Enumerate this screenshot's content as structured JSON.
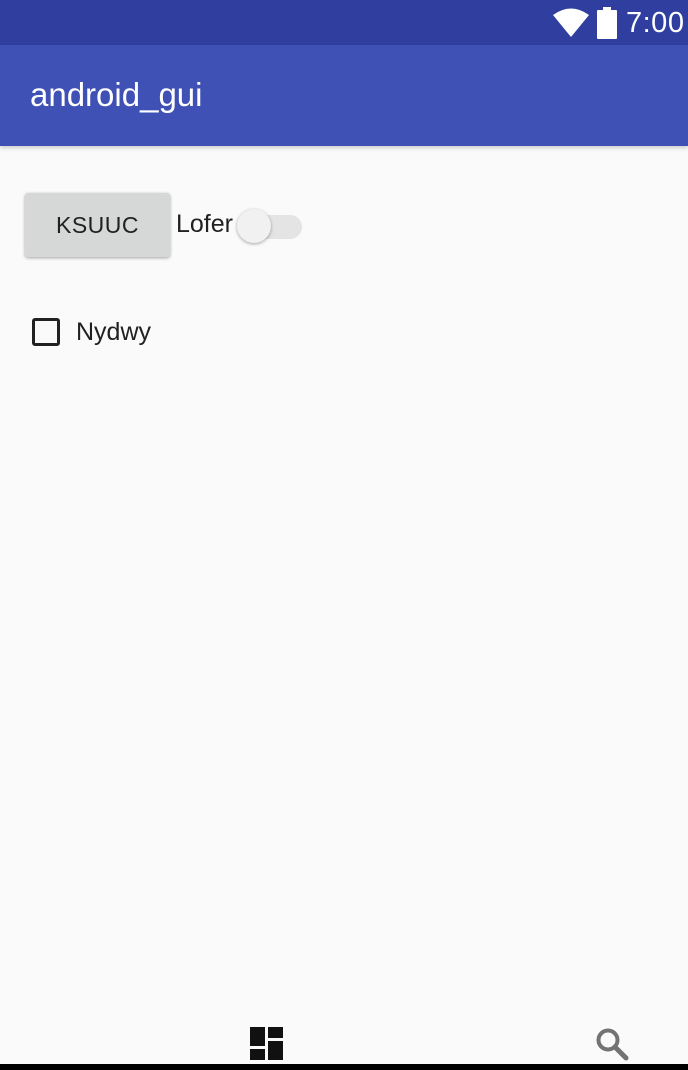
{
  "status_bar": {
    "time": "7:00",
    "icons": [
      "wifi-icon",
      "battery-icon"
    ]
  },
  "app_bar": {
    "title": "android_gui"
  },
  "content": {
    "button_label": "KSUUC",
    "switch": {
      "label": "Lofer",
      "checked": false
    },
    "checkbox": {
      "label": "Nydwy",
      "checked": false
    }
  },
  "bottom_nav": {
    "icons": [
      "dashboard-icon",
      "search-icon"
    ]
  },
  "colors": {
    "status_bar": "#303f9f",
    "app_bar": "#3f51b5",
    "background": "#fafafa",
    "button": "#d6d7d7",
    "text": "#212121"
  }
}
